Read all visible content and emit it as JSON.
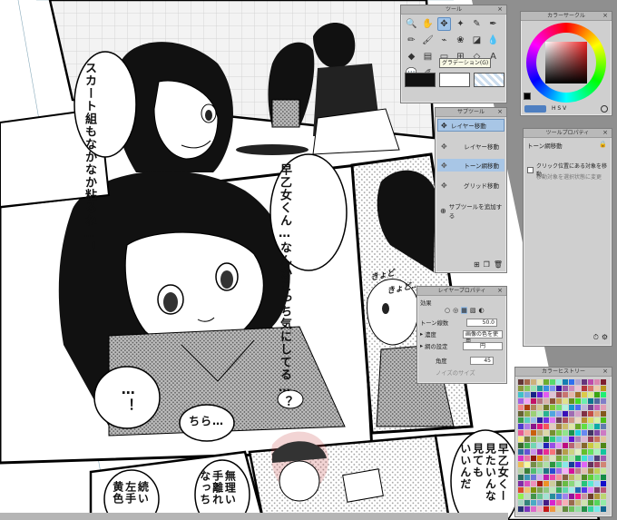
{
  "manga": {
    "bubble1": [
      "スカート組も",
      "なかなか",
      "粘るね…！"
    ],
    "bubble2": [
      "早乙女くん…",
      "なんかこっち",
      "気にしてる…？"
    ],
    "bubble3": "…！",
    "bubble4": "ちら…",
    "bubble5": [
      "早乙女くー",
      "見たいんな",
      "見ても",
      "いいんだ"
    ],
    "bubble6": [
      "無理い",
      "手離れ",
      "なっち"
    ],
    "bubble7": [
      "続い",
      "左手",
      "黄色"
    ],
    "sfx1": "きょど",
    "sfx2": "きょど…"
  },
  "tool_panel": {
    "title": "ツール",
    "tooltip": "グラデーション(G)",
    "tools": [
      {
        "icon": "magnifier-icon",
        "glyph": "🔍"
      },
      {
        "icon": "hand-icon",
        "glyph": "✋"
      },
      {
        "icon": "move-icon",
        "glyph": "✥"
      },
      {
        "icon": "magic-wand-icon",
        "glyph": "✦"
      },
      {
        "icon": "eyedropper-icon",
        "glyph": "✎"
      },
      {
        "icon": "pen-icon",
        "glyph": "✒"
      },
      {
        "icon": "pencil-icon",
        "glyph": "✏"
      },
      {
        "icon": "brush-icon",
        "glyph": "🖌"
      },
      {
        "icon": "airbrush-icon",
        "glyph": "⌁"
      },
      {
        "icon": "decoration-icon",
        "glyph": "❀"
      },
      {
        "icon": "eraser-icon",
        "glyph": "◪"
      },
      {
        "icon": "blend-icon",
        "glyph": "💧"
      },
      {
        "icon": "fill-icon",
        "glyph": "◆"
      },
      {
        "icon": "gradient-icon",
        "glyph": "▤"
      },
      {
        "icon": "figure-icon",
        "glyph": "▭"
      },
      {
        "icon": "frame-icon",
        "glyph": "⊞"
      },
      {
        "icon": "ruler-icon",
        "glyph": "◇"
      },
      {
        "icon": "text-icon",
        "glyph": "A"
      },
      {
        "icon": "balloon-icon",
        "glyph": "💬"
      },
      {
        "icon": "correct-line-icon",
        "glyph": "✐"
      }
    ],
    "main_color": "#111111",
    "sub_color": "#ffffff"
  },
  "color_wheel_panel": {
    "title": "カラーサークル",
    "hsv": "H S V"
  },
  "subtool_panel": {
    "title": "サブツール",
    "header": "レイヤー移動",
    "items": [
      "レイヤー移動",
      "トーン網移動",
      "グリッド移動"
    ],
    "add_label": "サブツールを追加する"
  },
  "toolprop_panel": {
    "title": "ツールプロパティ",
    "header": "トーン網移動",
    "checkbox_label": "クリック位置にある対象を移動",
    "option_label": "移動対象を選択状態に変更"
  },
  "layerprop_panel": {
    "title": "レイヤープロパティ",
    "effect_label": "効果",
    "tone_label": "トーン線数",
    "tone_value": "50.0",
    "density_label": "濃度",
    "density_value": "画像の色を使用",
    "dot_label": "網の設定",
    "dot_value": "円",
    "angle_label": "角度",
    "angle_value": "45",
    "size_label": "ノイズのサイズ"
  },
  "colorhist_panel": {
    "title": "カラーヒストリー"
  }
}
